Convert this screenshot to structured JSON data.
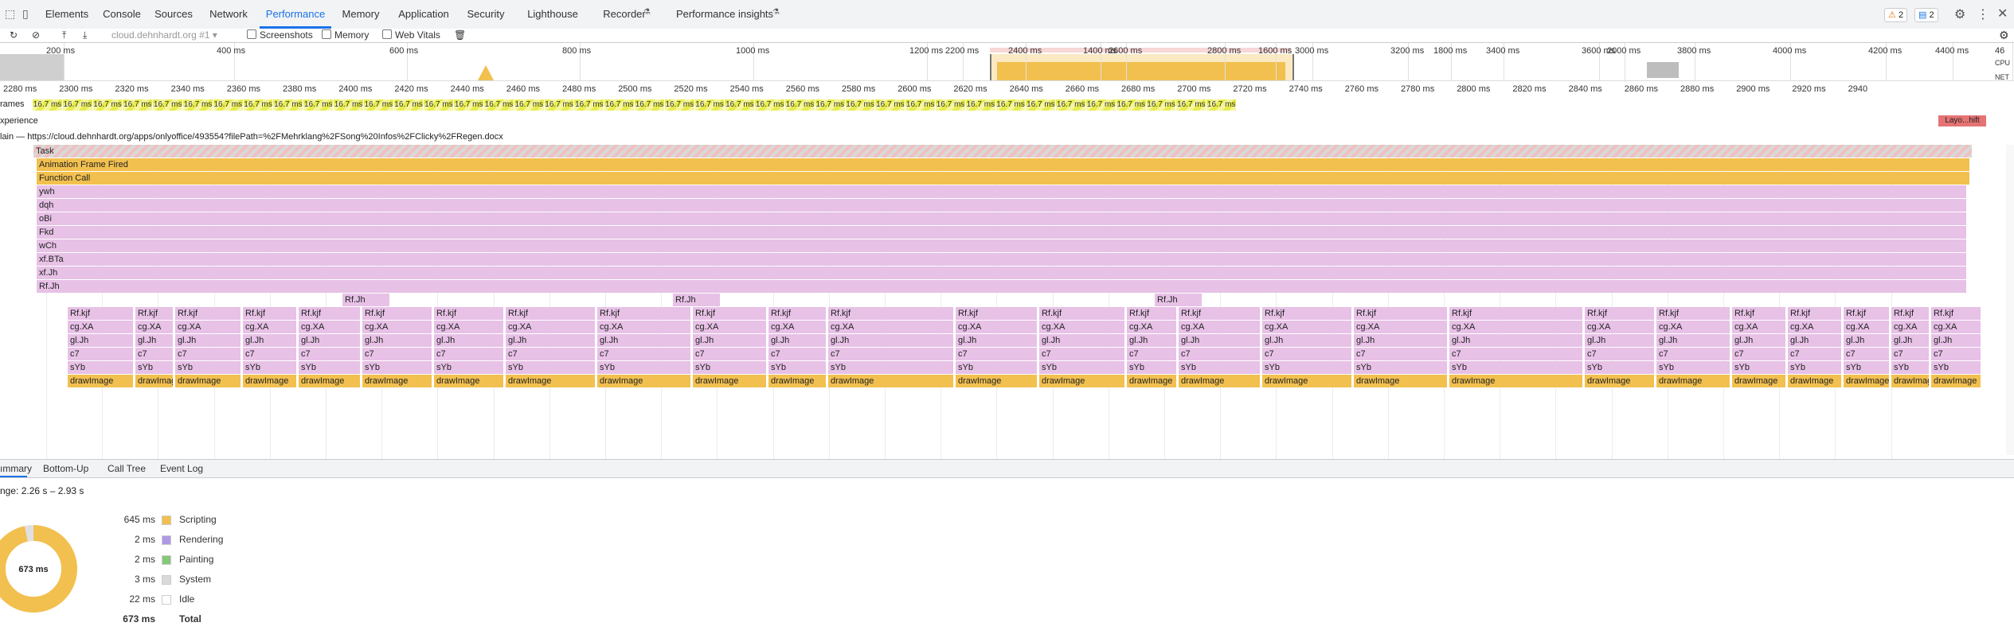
{
  "tabs": [
    "Elements",
    "Console",
    "Sources",
    "Network",
    "Performance",
    "Memory",
    "Application",
    "Security",
    "Lighthouse",
    "Recorder",
    "Performance insights"
  ],
  "badges": {
    "warnings": "2",
    "messages": "2"
  },
  "toolbar": {
    "record_target": "cloud.dehnhardt.org #1",
    "screenshots_label": "Screenshots",
    "memory_label": "Memory",
    "webvitals_label": "Web Vitals"
  },
  "overview": {
    "ticks": [
      "200 ms",
      "400 ms",
      "600 ms",
      "800 ms",
      "1000 ms",
      "1200 ms",
      "1400 ms",
      "1600 ms",
      "1800 ms",
      "2000 ms",
      "2200 ms",
      "2400 ms",
      "2600 ms",
      "2800 ms",
      "3000 ms",
      "3200 ms",
      "3400 ms",
      "3600 ms",
      "3800 ms",
      "4000 ms",
      "4200 ms",
      "4400 ms",
      "46"
    ],
    "cpu_label": "CPU",
    "net_label": "NET"
  },
  "ruler": [
    "2280 ms",
    "2300 ms",
    "2320 ms",
    "2340 ms",
    "2360 ms",
    "2380 ms",
    "2400 ms",
    "2420 ms",
    "2440 ms",
    "2460 ms",
    "2480 ms",
    "2500 ms",
    "2520 ms",
    "2540 ms",
    "2560 ms",
    "2580 ms",
    "2600 ms",
    "2620 ms",
    "2640 ms",
    "2660 ms",
    "2680 ms",
    "2700 ms",
    "2720 ms",
    "2740 ms",
    "2760 ms",
    "2780 ms",
    "2800 ms",
    "2820 ms",
    "2840 ms",
    "2860 ms",
    "2880 ms",
    "2900 ms",
    "2920 ms",
    "2940"
  ],
  "tracks": {
    "frames_label": "rames",
    "frame_duration": "16.7 ms",
    "experience_label": "xperience",
    "layout_shift": "Layo...hift",
    "main_label": "lain — https://cloud.dehnhardt.org/apps/onlyoffice/493554?filePath=%2FMehrklang%2FSong%20Infos%2FClicky%2FRegen.docx"
  },
  "flame_rows": [
    "Task",
    "Animation Frame Fired",
    "Function Call",
    "ywh",
    "dqh",
    "oBi",
    "Fkd",
    "wCh",
    "xf.BTa",
    "xf.Jh",
    "Rf.Jh"
  ],
  "flame_detail": {
    "rfjh2": "Rf.Jh",
    "rfkjf": "Rf.kjf",
    "cgxa": "cg.XA",
    "gljh": "gl.Jh",
    "c7": "c7",
    "syb": "sYb",
    "draw": "drawImage"
  },
  "bottom_tabs": [
    "ımmary",
    "Bottom-Up",
    "Call Tree",
    "Event Log"
  ],
  "summary": {
    "range": "nge: 2.26 s – 2.93 s",
    "total_center": "673 ms",
    "rows": [
      {
        "value": "645 ms",
        "name": "Scripting",
        "color": "#f2c04f"
      },
      {
        "value": "2 ms",
        "name": "Rendering",
        "color": "#af98e6"
      },
      {
        "value": "2 ms",
        "name": "Painting",
        "color": "#86c779"
      },
      {
        "value": "3 ms",
        "name": "System",
        "color": "#d9d9d9"
      },
      {
        "value": "22 ms",
        "name": "Idle",
        "color": "#ffffff"
      }
    ],
    "total": {
      "value": "673 ms",
      "name": "Total"
    }
  }
}
